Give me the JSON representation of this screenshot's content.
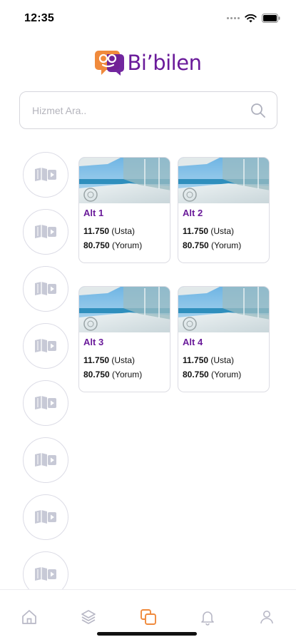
{
  "status_bar": {
    "time": "12:35"
  },
  "brand": {
    "name": "Bi’bilen",
    "primary_color": "#6a1b9a",
    "accent_color": "#f08a3c"
  },
  "search": {
    "placeholder": "Hizmet Ara..",
    "value": ""
  },
  "categories": [
    {
      "icon": "book-video-icon"
    },
    {
      "icon": "book-video-icon"
    },
    {
      "icon": "book-video-icon"
    },
    {
      "icon": "book-video-icon"
    },
    {
      "icon": "book-video-icon"
    },
    {
      "icon": "book-video-icon"
    },
    {
      "icon": "book-video-icon"
    },
    {
      "icon": "book-video-icon"
    }
  ],
  "cards": [
    {
      "title": "Alt 1",
      "usta_count": "11.750",
      "usta_label": "(Usta)",
      "yorum_count": "80.750",
      "yorum_label": "(Yorum)"
    },
    {
      "title": "Alt 2",
      "usta_count": "11.750",
      "usta_label": "(Usta)",
      "yorum_count": "80.750",
      "yorum_label": "(Yorum)"
    },
    {
      "title": "Alt 3",
      "usta_count": "11.750",
      "usta_label": "(Usta)",
      "yorum_count": "80.750",
      "yorum_label": "(Yorum)"
    },
    {
      "title": "Alt 4",
      "usta_count": "11.750",
      "usta_label": "(Usta)",
      "yorum_count": "80.750",
      "yorum_label": "(Yorum)"
    }
  ],
  "tab_bar": {
    "active": "services",
    "active_color": "#f08a3c",
    "inactive_color": "#b8b8c6",
    "tabs": [
      {
        "id": "home",
        "icon": "home-icon"
      },
      {
        "id": "layers",
        "icon": "layers-icon"
      },
      {
        "id": "services",
        "icon": "copy-icon"
      },
      {
        "id": "notifications",
        "icon": "bell-icon"
      },
      {
        "id": "profile",
        "icon": "user-icon"
      }
    ]
  }
}
